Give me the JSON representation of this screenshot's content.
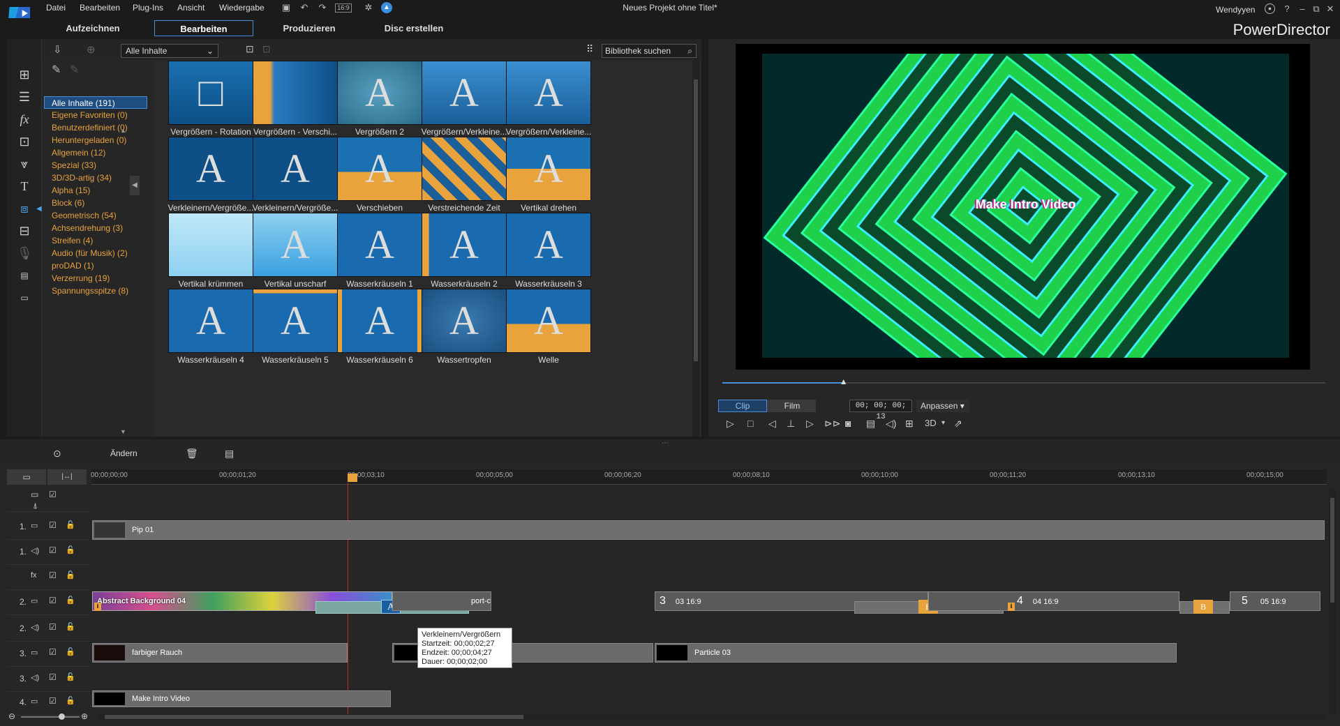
{
  "menu": [
    "Datei",
    "Bearbeiten",
    "Plug-Ins",
    "Ansicht",
    "Wiedergabe"
  ],
  "window_title": "Neues Projekt ohne Titel*",
  "user": "Wendyyen",
  "brand": "PowerDirector",
  "tabs": [
    "Aufzeichnen",
    "Bearbeiten",
    "Produzieren",
    "Disc erstellen"
  ],
  "aspect": "16:9",
  "library": {
    "dropdown": "Alle Inhalte",
    "search_placeholder": "Bibliothek suchen",
    "categories": [
      "Alle Inhalte (191)",
      "Eigene Favoriten  (0)",
      "Benutzerdefiniert  (0)",
      "Heruntergeladen  (0)",
      "Allgemein  (12)",
      "Spezial  (33)",
      "3D/3D-artig  (34)",
      "Alpha  (15)",
      "Block  (6)",
      "Geometrisch  (54)",
      "Achsendrehung  (3)",
      "Streifen  (4)",
      "Audio (für Musik)  (2)",
      "proDAD  (1)",
      "Verzerrung  (19)",
      "Spannungsspitze  (8)"
    ],
    "items": [
      "Vergrößern - Rotation",
      "Vergrößern - Verschi...",
      "Vergrößern 2",
      "Vergrößern/Verkleine...",
      "Vergrößern/Verkleine...",
      "Verkleinern/Vergröße...",
      "Verkleinern/Vergröße...",
      "Verschieben",
      "Verstreichende Zeit",
      "Vertikal drehen",
      "Vertikal krümmen",
      "Vertikal unscharf",
      "Wasserkräuseln 1",
      "Wasserkräuseln 2",
      "Wasserkräuseln 3",
      "Wasserkräuseln 4",
      "Wasserkräuseln 5",
      "Wasserkräuseln 6",
      "Wassertropfen",
      "Welle"
    ]
  },
  "preview": {
    "text": "Make Intro Video",
    "mode_clip": "Clip",
    "mode_film": "Film",
    "timecode": "00; 00; 00; 13",
    "fit": "Anpassen",
    "three_d": "3D",
    "progress": 0.2
  },
  "timeline": {
    "modify": "Ändern",
    "ruler": [
      "00;00;00;00",
      "00;00;01;20",
      "00;00;03;10",
      "00;00;05;00",
      "00;00;06;20",
      "00;00;08;10",
      "00;00;10;00",
      "00;00;11;20",
      "00;00;13;10",
      "00;00;15;00"
    ],
    "track_labels": [
      "1.",
      "1.",
      "2.",
      "2.",
      "3.",
      "3.",
      "4."
    ],
    "clips": {
      "pip": "Pip 01",
      "abstract": "Abstract Background 04",
      "port": "port-c",
      "t3": "3",
      "t3b": "03 16:9",
      "t4": "4",
      "t4b": "04 16:9",
      "t5": "5",
      "t5b": "05 16:9",
      "rauch": "farbiger Rauch",
      "particle": "Particle 03",
      "intro": "Make Intro Video"
    },
    "tooltip": {
      "title": "Verkleinern/Vergrößern",
      "start": "Startzeit: 00;00;02;27",
      "end": "Endzeit: 00;00;04;27",
      "dur": "Dauer: 00;00;02;00"
    }
  }
}
